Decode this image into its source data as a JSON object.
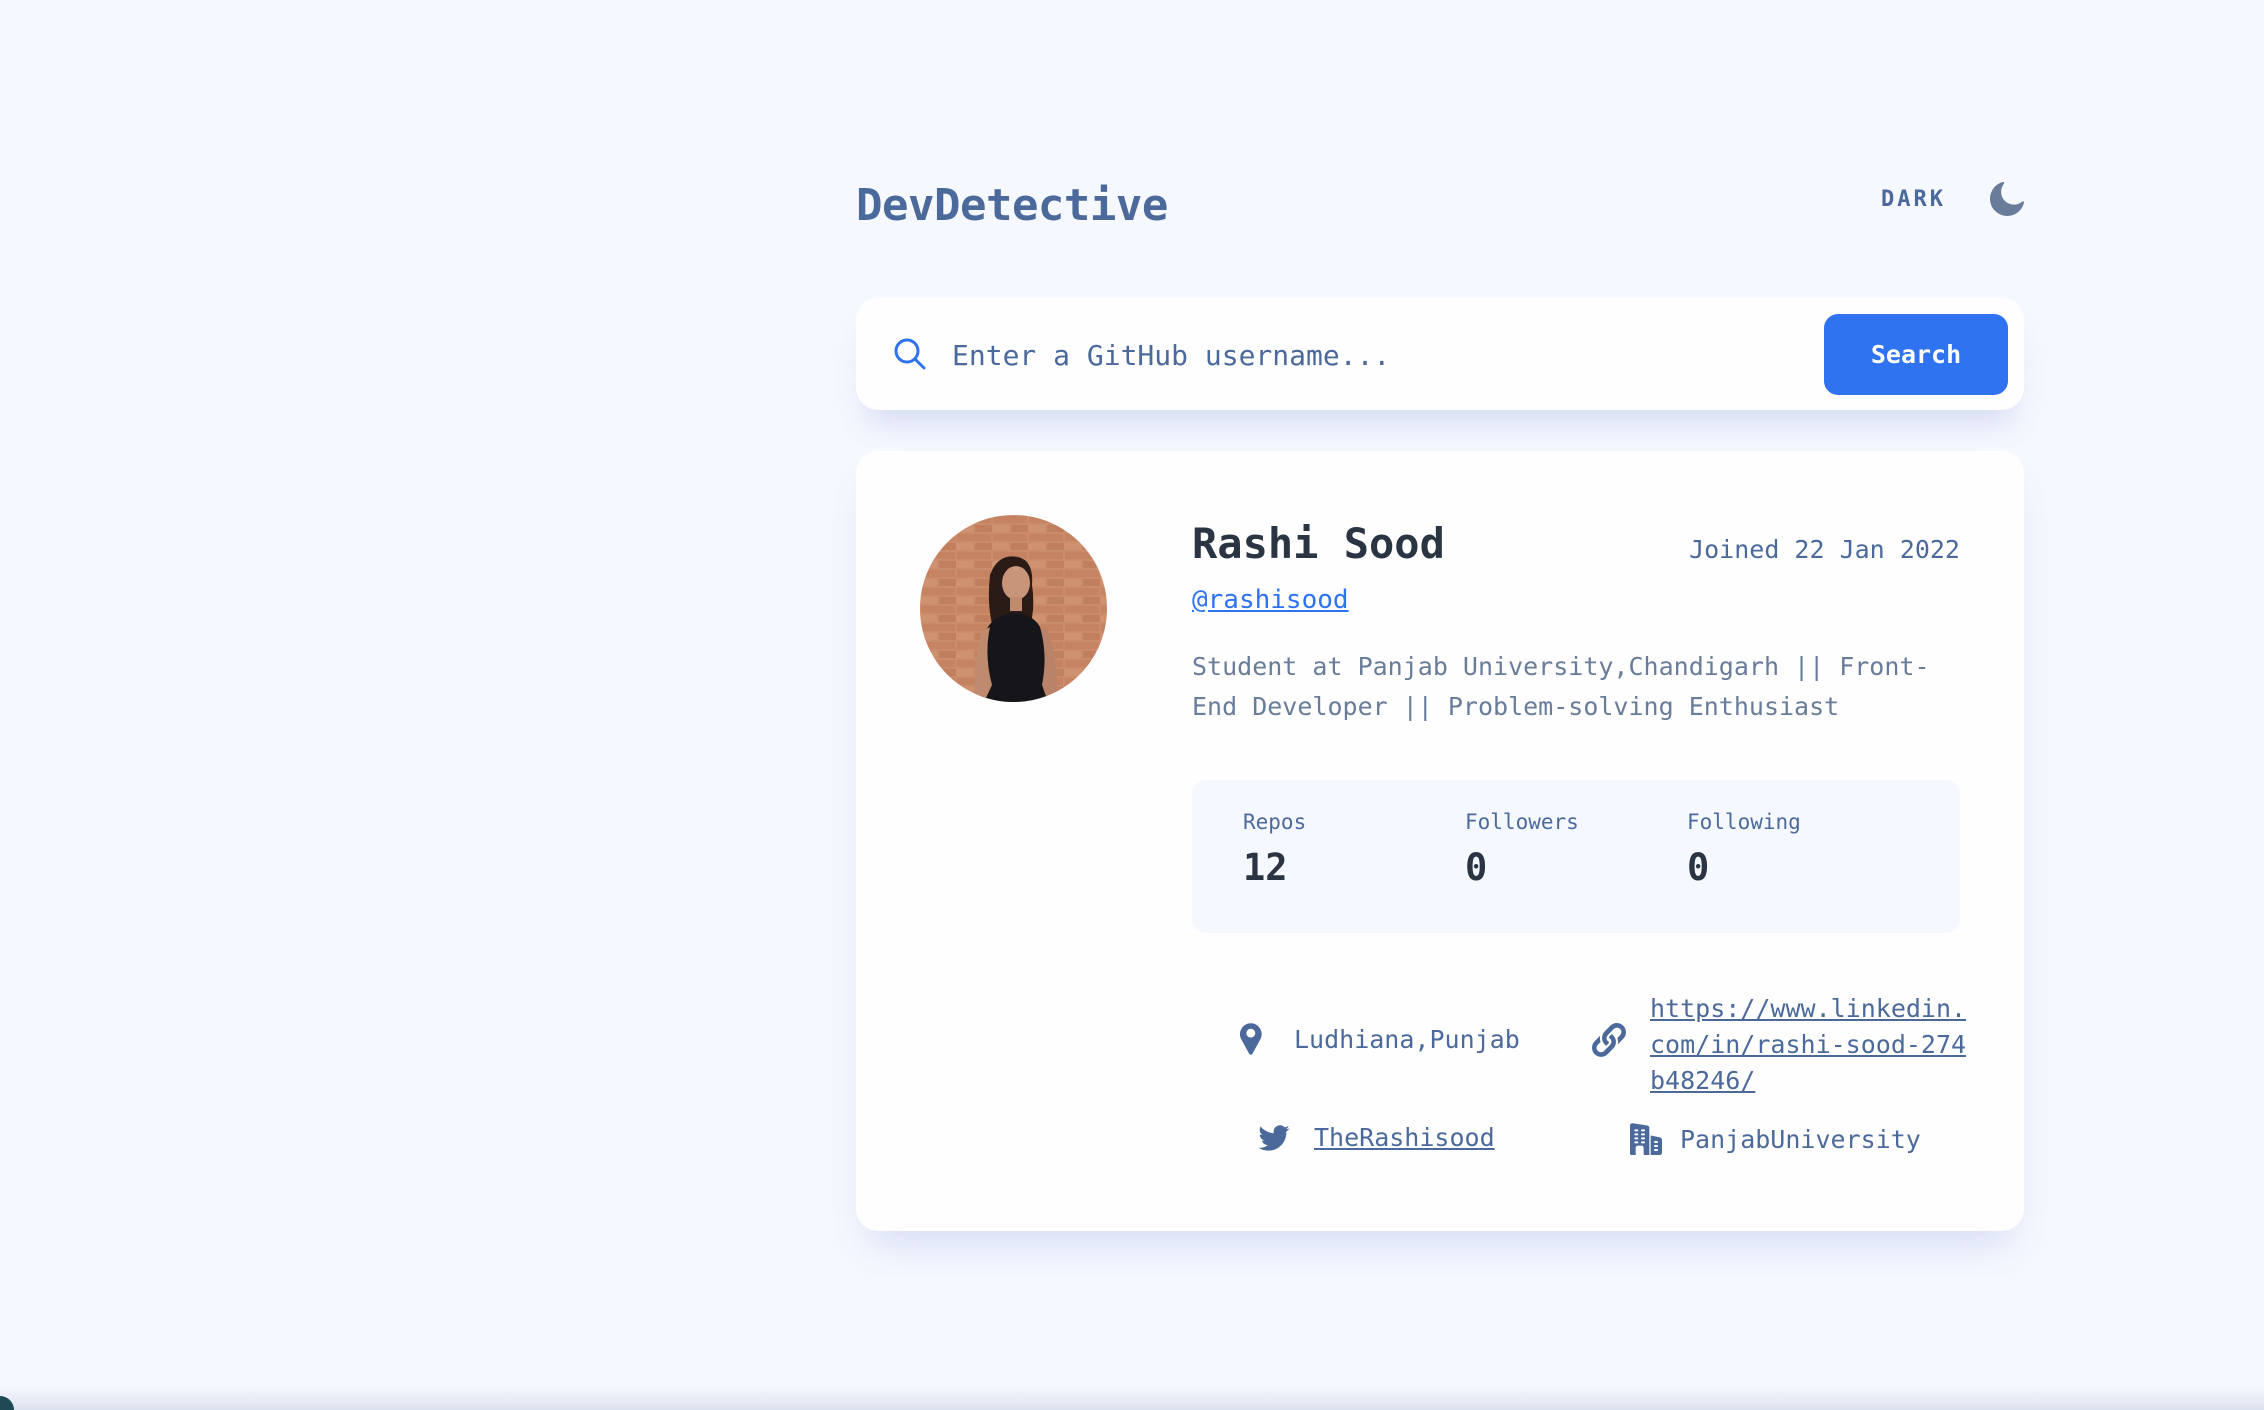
{
  "header": {
    "app_title": "DevDetective",
    "theme_toggle_label": "DARK",
    "theme_icon": "moon-icon"
  },
  "search": {
    "icon": "search-icon",
    "placeholder": "Enter a GitHub username...",
    "value": "",
    "button_label": "Search"
  },
  "profile": {
    "avatar": "avatar",
    "name": "Rashi Sood",
    "joined": "Joined 22 Jan 2022",
    "handle": "@rashisood",
    "bio": "Student at Panjab University,Chandigarh || Front-End Developer || Problem-solving Enthusiast",
    "stats": [
      {
        "label": "Repos",
        "value": "12"
      },
      {
        "label": "Followers",
        "value": "0"
      },
      {
        "label": "Following",
        "value": "0"
      }
    ],
    "location": {
      "icon": "location-pin-icon",
      "text": "Ludhiana,Punjab"
    },
    "blog": {
      "icon": "link-icon",
      "text": "https://www.linkedin.com/in/rashi-sood-274b48246/"
    },
    "twitter": {
      "icon": "twitter-icon",
      "text": "TheRashisood"
    },
    "company": {
      "icon": "building-icon",
      "text": "PanjabUniversity"
    }
  },
  "colors": {
    "background": "#f6f8ff",
    "card": "#fefefe",
    "accent": "#2f73f0",
    "text_primary": "#2b3442",
    "text_secondary": "#4b6a9b"
  }
}
